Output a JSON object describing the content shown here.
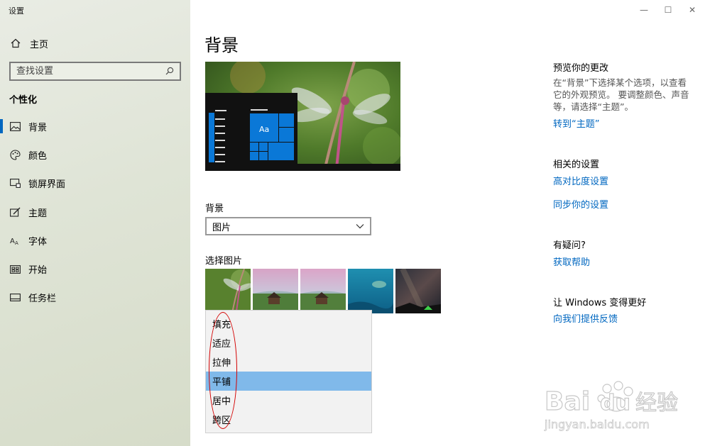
{
  "window": {
    "title": "设置",
    "minimize": "—",
    "maximize": "☐",
    "close": "✕"
  },
  "sidebar": {
    "home_label": "主页",
    "search_placeholder": "查找设置",
    "section_title": "个性化",
    "items": [
      {
        "label": "背景",
        "icon": "image-icon"
      },
      {
        "label": "颜色",
        "icon": "palette-icon"
      },
      {
        "label": "锁屏界面",
        "icon": "lock-screen-icon"
      },
      {
        "label": "主题",
        "icon": "theme-icon"
      },
      {
        "label": "字体",
        "icon": "font-icon"
      },
      {
        "label": "开始",
        "icon": "start-icon"
      },
      {
        "label": "任务栏",
        "icon": "taskbar-icon"
      }
    ]
  },
  "main": {
    "title": "背景",
    "preview_tile_label": "Aa",
    "background_label": "背景",
    "background_value": "图片",
    "choose_picture_label": "选择图片",
    "fit_options": [
      "填充",
      "适应",
      "拉伸",
      "平铺",
      "居中",
      "跨区"
    ],
    "fit_selected": "平铺"
  },
  "right_pane": {
    "preview_heading": "预览你的更改",
    "preview_text": "在“背景”下选择某个选项，以查看它的外观预览。 要调整颜色、声音等，请选择“主题”。",
    "goto_theme_link": "转到“主题”",
    "related_heading": "相关的设置",
    "high_contrast_link": "高对比度设置",
    "sync_link": "同步你的设置",
    "question_heading": "有疑问?",
    "help_link": "获取帮助",
    "better_heading": "让 Windows 变得更好",
    "feedback_link": "向我们提供反馈"
  },
  "watermark": {
    "brand": "Bai",
    "brand_suffix": "du",
    "product": "经验",
    "url": "jingyan.baidu.com"
  },
  "colors": {
    "accent": "#0067c0",
    "dropdown_selected": "#80b9ea",
    "annotation": "#d40000"
  }
}
